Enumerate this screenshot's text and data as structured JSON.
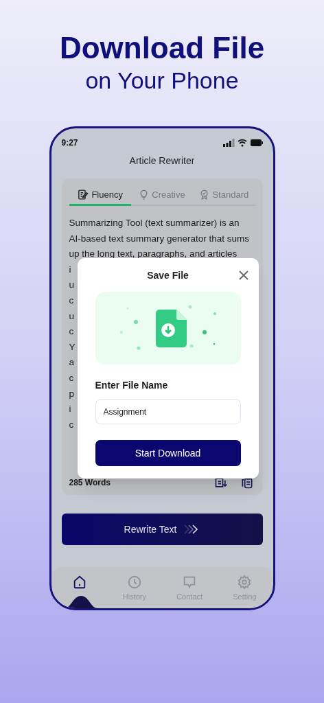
{
  "headline": {
    "title": "Download File",
    "subtitle": "on Your Phone"
  },
  "status_bar": {
    "time": "9:27"
  },
  "screen_title": "Article Rewriter",
  "tabs": [
    {
      "label": "Fluency",
      "selected": true
    },
    {
      "label": "Creative",
      "selected": false
    },
    {
      "label": "Standard",
      "selected": false
    }
  ],
  "text_lines": [
    "Summarizing Tool (text summarizer) is an",
    "AI-based text summary generator that sums",
    "up the long text, paragraphs, and articles",
    "i",
    "u",
    "c",
    "u",
    "c",
    "Y",
    "a",
    "c",
    "p",
    "i",
    "c"
  ],
  "word_count": "285 Words",
  "rewrite_button": "Rewrite Text",
  "nav": [
    {
      "selected": true
    },
    {
      "label": "History",
      "selected": false
    },
    {
      "label": "Contact",
      "selected": false
    },
    {
      "label": "Setting",
      "selected": false
    }
  ],
  "dialog": {
    "title": "Save File",
    "field_label": "Enter File Name",
    "field_value": "Assignment",
    "button": "Start Download"
  }
}
